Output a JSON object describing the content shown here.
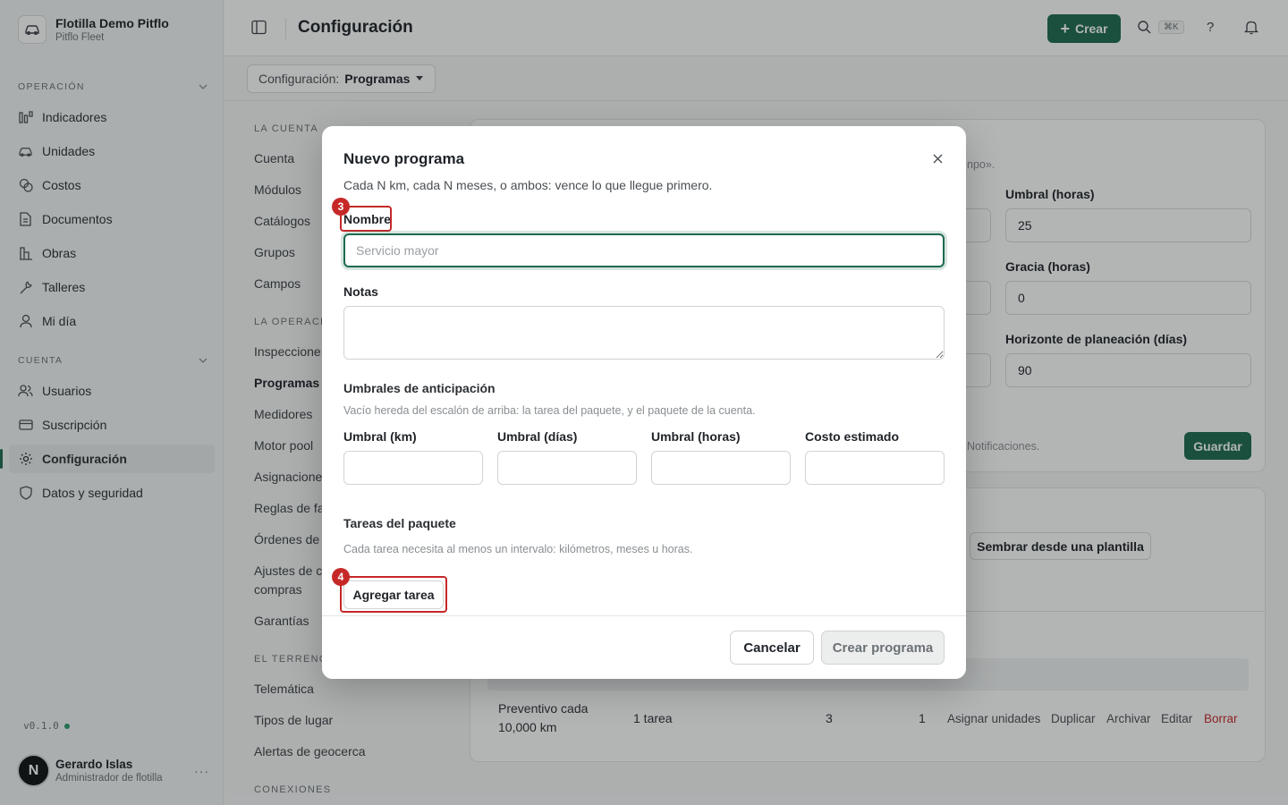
{
  "org": {
    "name": "Flotilla Demo Pitflo",
    "subtitle": "Pitflo Fleet"
  },
  "sidebar": {
    "sections": [
      {
        "title": "OPERACIÓN",
        "items": [
          {
            "label": "Indicadores",
            "icon": "chart-bars-icon"
          },
          {
            "label": "Unidades",
            "icon": "car-icon"
          },
          {
            "label": "Costos",
            "icon": "coins-icon"
          },
          {
            "label": "Documentos",
            "icon": "document-icon"
          },
          {
            "label": "Obras",
            "icon": "buildings-icon"
          },
          {
            "label": "Talleres",
            "icon": "wrench-icon"
          },
          {
            "label": "Mi día",
            "icon": "user-icon"
          }
        ]
      },
      {
        "title": "CUENTA",
        "items": [
          {
            "label": "Usuarios",
            "icon": "users-icon"
          },
          {
            "label": "Suscripción",
            "icon": "card-icon"
          },
          {
            "label": "Configuración",
            "icon": "gear-icon",
            "active": true
          },
          {
            "label": "Datos y seguridad",
            "icon": "shield-icon"
          }
        ]
      }
    ],
    "version": "v0.1.0",
    "user": {
      "initial": "N",
      "name": "Gerardo Islas",
      "role": "Administrador de flotilla",
      "more": "···"
    }
  },
  "topbar": {
    "title": "Configuración",
    "create_label": "Crear",
    "search_shortcut": "⌘K",
    "help": "?"
  },
  "subbar": {
    "prefix": "Configuración:",
    "value": "Programas"
  },
  "settings_nav": {
    "groups": [
      {
        "title": "LA CUENTA",
        "items": [
          "Cuenta",
          "Módulos",
          "Catálogos",
          "Grupos",
          "Campos"
        ]
      },
      {
        "title": "LA OPERACI",
        "items": [
          "Inspeccione",
          "Programas",
          "Medidores",
          "Motor pool",
          "Asignacione",
          "Reglas de fa",
          "Órdenes de",
          "Ajustes de c",
          "compras",
          "Garantías"
        ]
      },
      {
        "title": "EL TERRENO",
        "items": [
          "Telemática",
          "Tipos de lugar",
          "Alertas de geocerca"
        ]
      },
      {
        "title": "CONEXIONES",
        "items": []
      }
    ]
  },
  "background": {
    "hint_fragment": "npo».",
    "fields": [
      {
        "label": "Umbral (horas)",
        "value": "25"
      },
      {
        "label": "Gracia (horas)",
        "value": "0"
      },
      {
        "label": "Horizonte de planeación (días)",
        "value": "90"
      }
    ],
    "notif_fragment": "Notificaciones.",
    "save_label": "Guardar",
    "seed_label": "Sembrar desde una plantilla",
    "row": {
      "name_line1": "Preventivo cada",
      "name_line2": "10,000 km",
      "tasks": "1 tarea",
      "count_a": "3",
      "count_b": "1",
      "actions": [
        "Asignar unidades",
        "Duplicar",
        "Archivar",
        "Editar",
        "Borrar"
      ]
    }
  },
  "modal": {
    "title": "Nuevo programa",
    "description": "Cada N km, cada N meses, o ambos: vence lo que llegue primero.",
    "name_label": "Nombre",
    "name_placeholder": "Servicio mayor",
    "notes_label": "Notas",
    "thresholds_title": "Umbrales de anticipación",
    "thresholds_help": "Vacío hereda del escalón de arriba: la tarea del paquete, y el paquete de la cuenta.",
    "threshold_fields": [
      "Umbral (km)",
      "Umbral (días)",
      "Umbral (horas)",
      "Costo estimado"
    ],
    "tasks_title": "Tareas del paquete",
    "tasks_help": "Cada tarea necesita al menos un intervalo: kilómetros, meses u horas.",
    "add_task_label": "Agregar tarea",
    "cancel_label": "Cancelar",
    "submit_label": "Crear programa",
    "annotations": [
      "3",
      "4"
    ]
  },
  "colors": {
    "accent": "#1e6b4e",
    "danger": "#c62828",
    "annotation": "#c62828"
  }
}
